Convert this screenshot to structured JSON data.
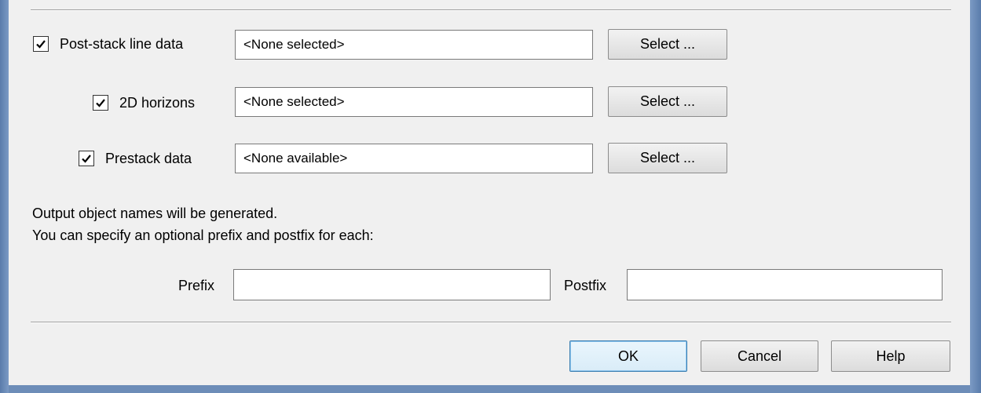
{
  "rows": [
    {
      "label": "Post-stack line data",
      "checked": true,
      "value": "<None selected>",
      "button": "Select ..."
    },
    {
      "label": "2D horizons",
      "checked": true,
      "value": "<None selected>",
      "button": "Select ..."
    },
    {
      "label": "Prestack data",
      "checked": true,
      "value": "<None available>",
      "button": "Select ..."
    }
  ],
  "info": {
    "line1": "Output object names will be generated.",
    "line2": "You can specify an optional prefix and postfix for each:"
  },
  "prefix": {
    "label": "Prefix",
    "value": ""
  },
  "postfix": {
    "label": "Postfix",
    "value": ""
  },
  "footer": {
    "ok": "OK",
    "cancel": "Cancel",
    "help": "Help"
  }
}
